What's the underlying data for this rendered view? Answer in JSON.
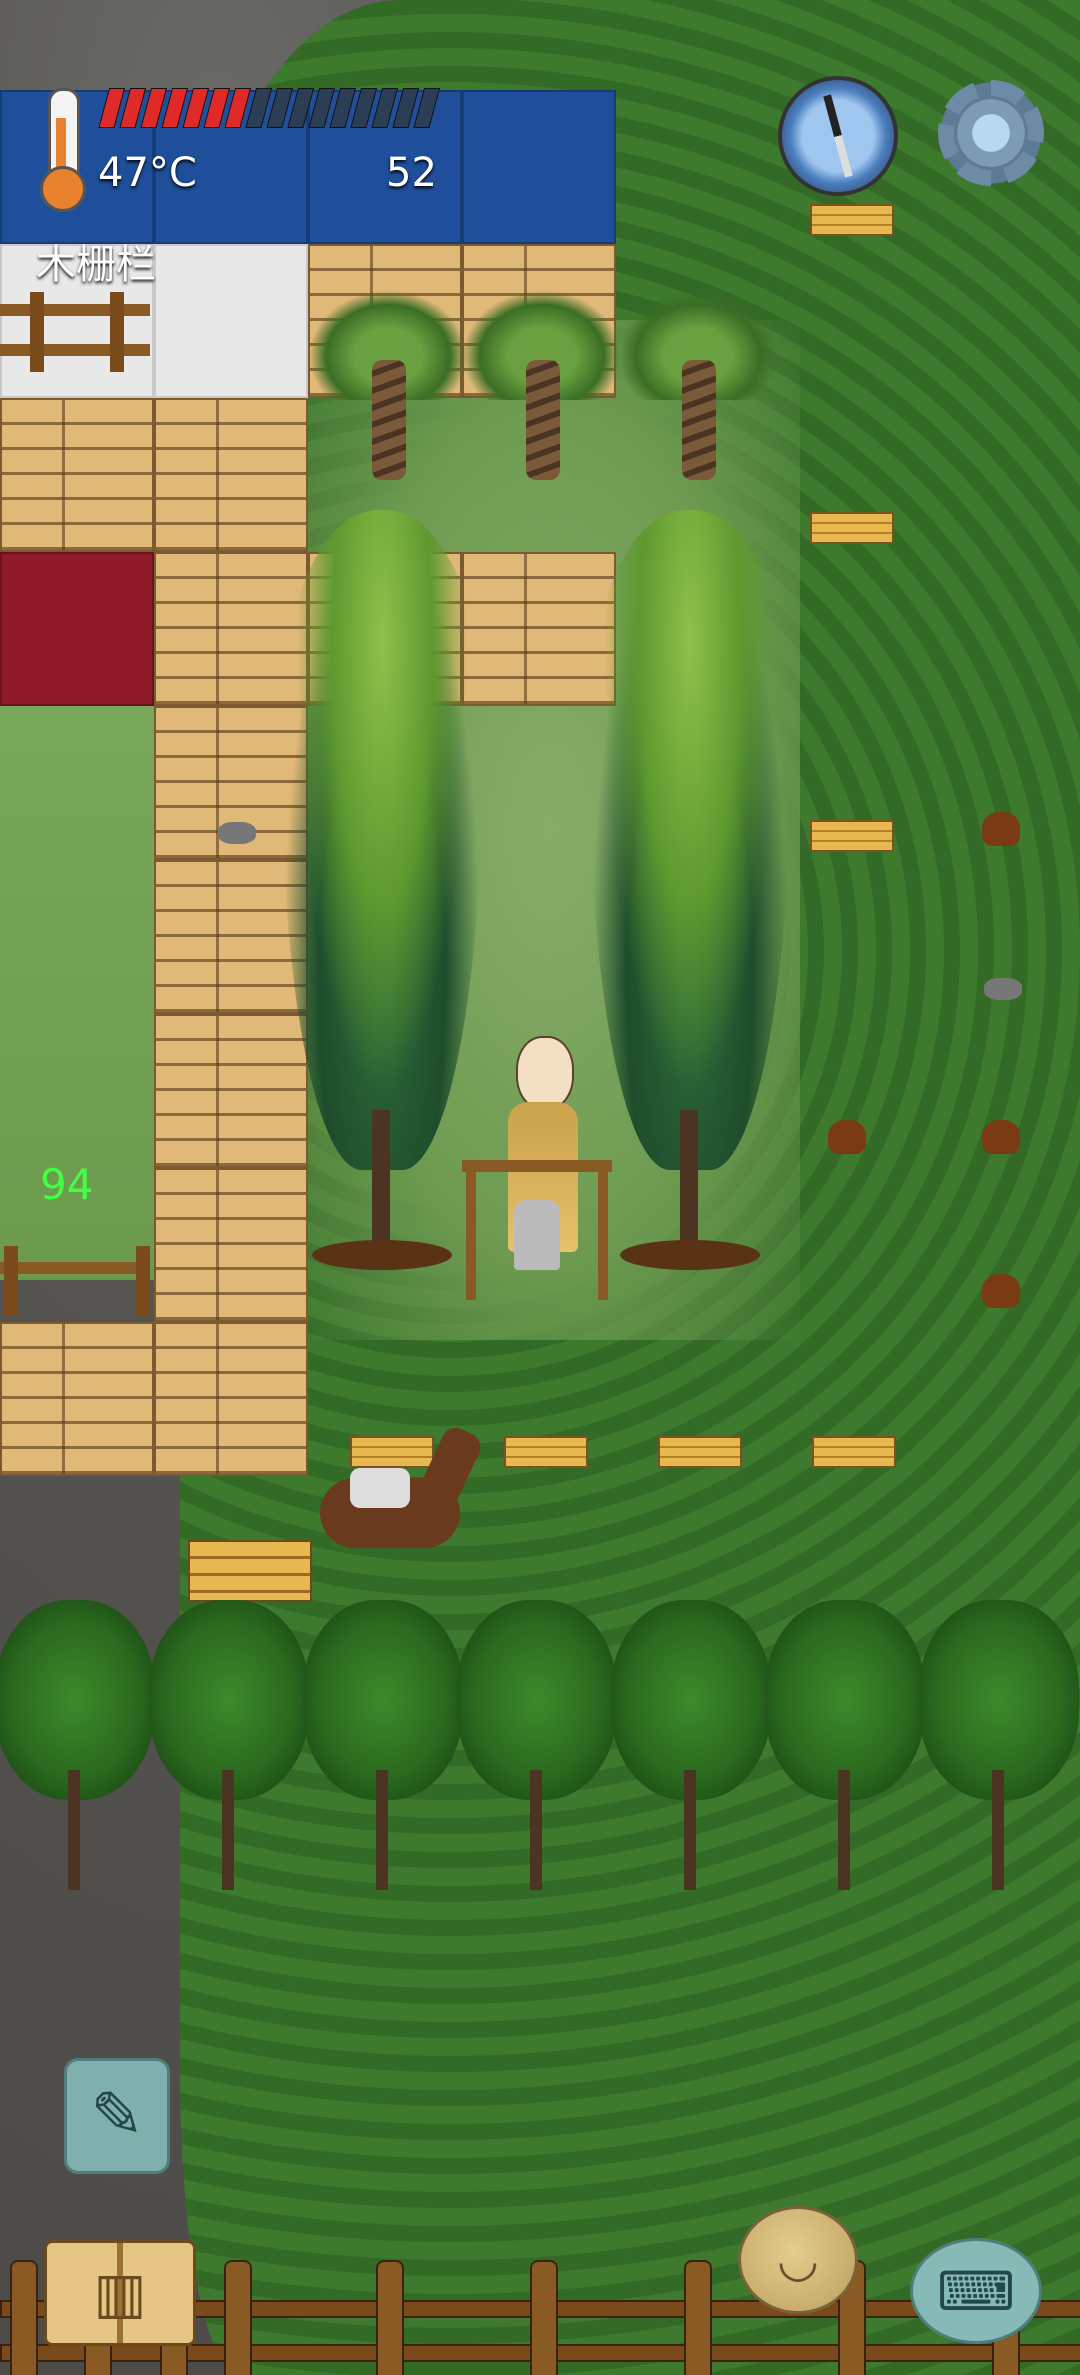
{
  "hud": {
    "temperature": "47°C",
    "center_value": "52",
    "food_bar": {
      "filled_segments": 7,
      "total_segments": 16
    },
    "object_label": "木栅栏",
    "floating_number": "94"
  },
  "buttons": {
    "compass": "compass-icon",
    "settings": "gear-icon",
    "note": "pencil-icon",
    "tech_book": "book-icon",
    "emote": "face-icon",
    "chat": "keyboard-icon"
  },
  "icons": {
    "pencil": "✎",
    "book": "▥",
    "face": "◡",
    "keyboard": "⌨"
  },
  "colors": {
    "food_on": "#e02a2a",
    "food_off": "#2c3e56",
    "floating_number": "#43ff43"
  }
}
